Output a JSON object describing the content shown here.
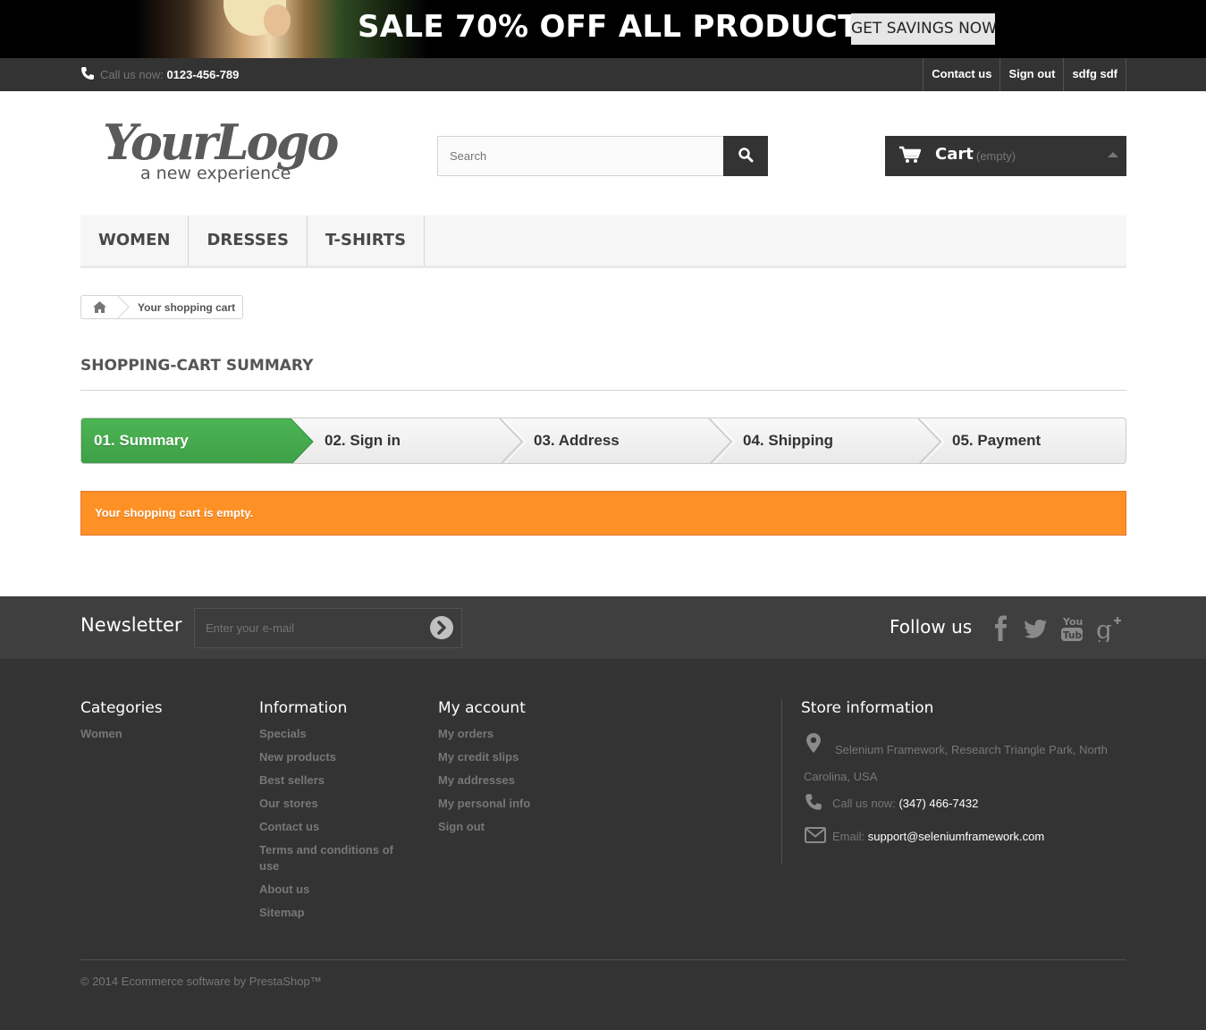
{
  "banner": {
    "headline": "SALE 70% OFF ALL PRODUCTS",
    "cta": "GET SAVINGS NOW"
  },
  "topbar": {
    "phone_prefix": "Call us now:",
    "phone_number": "0123-456-789",
    "links": [
      "Contact us",
      "Sign out",
      "sdfg sdf"
    ]
  },
  "header": {
    "logo_main": "YourLogo",
    "logo_tagline": "a new experience",
    "search_placeholder": "Search",
    "cart_label": "Cart",
    "cart_status": "(empty)"
  },
  "menu": [
    "WOMEN",
    "DRESSES",
    "T-SHIRTS"
  ],
  "breadcrumb": {
    "current": "Your shopping cart"
  },
  "page": {
    "title": "SHOPPING-CART SUMMARY",
    "steps": [
      "01. Summary",
      "02. Sign in",
      "03. Address",
      "04. Shipping",
      "05. Payment"
    ],
    "active_step": 0,
    "alert": "Your shopping cart is empty."
  },
  "newsletter": {
    "title": "Newsletter",
    "placeholder": "Enter your e-mail",
    "follow_title": "Follow us",
    "social": [
      "facebook-icon",
      "twitter-icon",
      "youtube-icon",
      "google-plus-icon"
    ]
  },
  "footer": {
    "categories": {
      "title": "Categories",
      "items": [
        "Women"
      ]
    },
    "information": {
      "title": "Information",
      "items": [
        "Specials",
        "New products",
        "Best sellers",
        "Our stores",
        "Contact us",
        "Terms and conditions of use",
        "About us",
        "Sitemap"
      ]
    },
    "account": {
      "title": "My account",
      "items": [
        "My orders",
        "My credit slips",
        "My addresses",
        "My personal info",
        "Sign out"
      ]
    },
    "store": {
      "title": "Store information",
      "address": "Selenium Framework, Research Triangle Park, North Carolina, USA",
      "phone_label": "Call us now:",
      "phone": "(347) 466-7432",
      "email_label": "Email:",
      "email": "support@seleniumframework.com"
    },
    "copyright": "© 2014 Ecommerce software by PrestaShop™"
  },
  "colors": {
    "active_step": "#46a74e",
    "alert": "#fe9126",
    "dark": "#333333"
  }
}
